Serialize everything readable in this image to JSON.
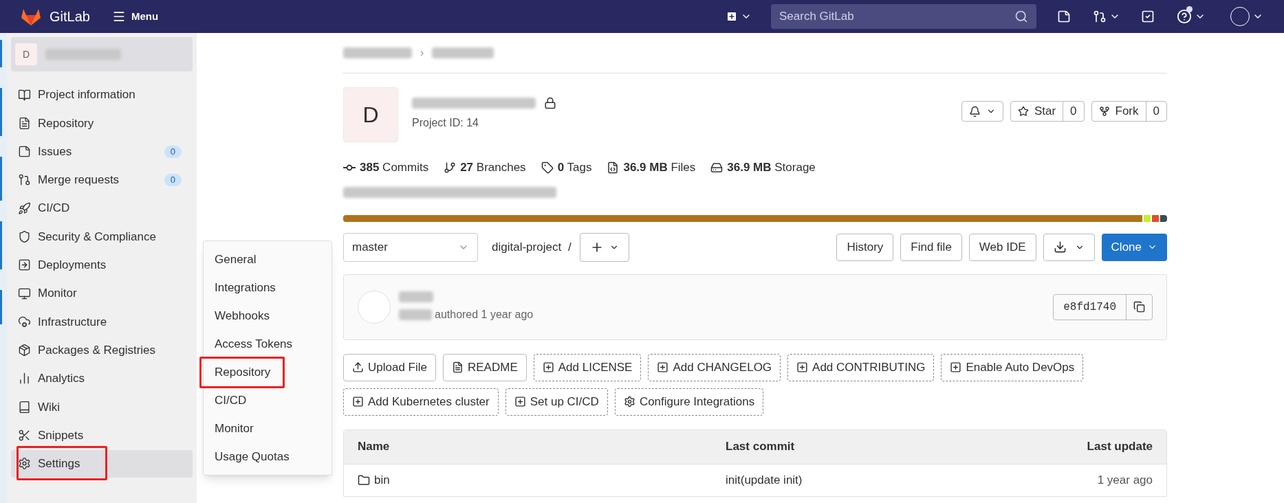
{
  "topbar": {
    "brand": "GitLab",
    "menu": "Menu",
    "search": {
      "placeholder": "Search GitLab"
    }
  },
  "sidebar": {
    "project_avatar": "D",
    "items": [
      {
        "label": "Project information",
        "selected": false,
        "highlighted": false
      },
      {
        "label": "Repository",
        "selected": false,
        "highlighted": false
      },
      {
        "label": "Issues",
        "count": "0",
        "selected": false,
        "highlighted": false
      },
      {
        "label": "Merge requests",
        "count": "0",
        "selected": false,
        "highlighted": false
      },
      {
        "label": "CI/CD",
        "selected": false,
        "highlighted": false
      },
      {
        "label": "Security & Compliance",
        "selected": false,
        "highlighted": false
      },
      {
        "label": "Deployments",
        "selected": false,
        "highlighted": false
      },
      {
        "label": "Monitor",
        "selected": false,
        "highlighted": false
      },
      {
        "label": "Infrastructure",
        "selected": false,
        "highlighted": false
      },
      {
        "label": "Packages & Registries",
        "selected": false,
        "highlighted": false
      },
      {
        "label": "Analytics",
        "selected": false,
        "highlighted": false
      },
      {
        "label": "Wiki",
        "selected": false,
        "highlighted": false
      },
      {
        "label": "Snippets",
        "selected": false,
        "highlighted": false
      },
      {
        "label": "Settings",
        "selected": true,
        "highlighted": true
      }
    ]
  },
  "flyout": {
    "items": [
      {
        "label": "General",
        "highlighted": false
      },
      {
        "label": "Integrations",
        "highlighted": false
      },
      {
        "label": "Webhooks",
        "highlighted": false
      },
      {
        "label": "Access Tokens",
        "highlighted": false
      },
      {
        "label": "Repository",
        "highlighted": true
      },
      {
        "label": "CI/CD",
        "highlighted": false
      },
      {
        "label": "Monitor",
        "highlighted": false
      },
      {
        "label": "Usage Quotas",
        "highlighted": false
      }
    ]
  },
  "breadcrumb_separator": "›",
  "project": {
    "avatar": "D",
    "project_id": "Project ID: 14",
    "star": {
      "label": "Star",
      "count": "0"
    },
    "fork": {
      "label": "Fork",
      "count": "0"
    },
    "stats": [
      "**385** Commits",
      "**27** Branches",
      "**0** Tags",
      "**36.9 MB** Files",
      "**36.9 MB** Storage"
    ],
    "languages": [
      {
        "color": "#b07219"
      },
      {
        "color": "#c1f12e"
      },
      {
        "color": "#e34c26"
      },
      {
        "color": "#384d54"
      }
    ]
  },
  "repo_nav": {
    "branch": "master",
    "path": "digital-project",
    "separator": "/",
    "buttons": [
      "History",
      "Find file",
      "Web IDE"
    ],
    "clone": "Clone"
  },
  "last_commit": {
    "meta": "authored 1 year ago",
    "sha": "e8fd1740"
  },
  "actions": [
    {
      "label": "Upload File",
      "kind": "upload"
    },
    {
      "label": "README",
      "kind": "file"
    },
    {
      "label": "Add LICENSE",
      "kind": "add"
    },
    {
      "label": "Add CHANGELOG",
      "kind": "add"
    },
    {
      "label": "Add CONTRIBUTING",
      "kind": "add"
    },
    {
      "label": "Enable Auto DevOps",
      "kind": "add"
    },
    {
      "label": "Add Kubernetes cluster",
      "kind": "add"
    },
    {
      "label": "Set up CI/CD",
      "kind": "add"
    },
    {
      "label": "Configure Integrations",
      "kind": "configure"
    }
  ],
  "table": {
    "columns": [
      "Name",
      "Last commit",
      "Last update"
    ],
    "rows": [
      {
        "name": "bin",
        "commit": "init(update init)",
        "updated": "1 year ago"
      }
    ]
  }
}
